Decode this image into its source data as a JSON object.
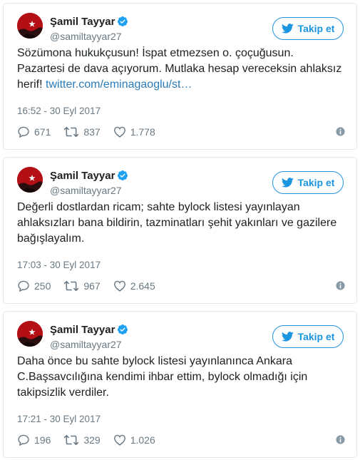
{
  "colors": {
    "accent": "#1b95e0",
    "link": "#2b7bb9",
    "muted": "#697882",
    "avatar_red": "#b40f14"
  },
  "icons": [
    "avatar",
    "verified-badge-icon",
    "twitter-bird-icon",
    "reply-icon",
    "retweet-icon",
    "like-heart-icon",
    "info-icon"
  ],
  "tweets": [
    {
      "name": "Şamil Tayyar",
      "handle": "@samiltayyar27",
      "follow_label": "Takip et",
      "line1": "Sözümona hukukçusun! İspat etmezsen o. çoçuğusun.",
      "line2": "Pazartesi de dava açıyorum. Mutlaka hesap vereceksin ahlaksız",
      "line3_text": "herif! ",
      "line3_link": "twitter.com/eminagaoglu/st…",
      "time": "16:52 - 30 Eyl 2017",
      "replies": "671",
      "retweets": "837",
      "likes": "1.778"
    },
    {
      "name": "Şamil Tayyar",
      "handle": "@samiltayyar27",
      "follow_label": "Takip et",
      "line1": "Değerli dostlardan ricam; sahte bylock listesi yayınlayan",
      "line2": "ahlaksızları bana bildirin, tazminatları şehit yakınları ve gazilere",
      "line3_text": "bağışlayalım.",
      "line3_link": "",
      "time": "17:03 - 30 Eyl 2017",
      "replies": "250",
      "retweets": "967",
      "likes": "2.645"
    },
    {
      "name": "Şamil Tayyar",
      "handle": "@samiltayyar27",
      "follow_label": "Takip et",
      "line1": "Daha önce bu sahte bylock listesi yayınlanınca Ankara",
      "line2": "C.Başsavcılığına kendimi ihbar ettim, bylock olmadığı için",
      "line3_text": "takipsizlik verdiler.",
      "line3_link": "",
      "time": "17:21 - 30 Eyl 2017",
      "replies": "196",
      "retweets": "329",
      "likes": "1.026"
    }
  ]
}
